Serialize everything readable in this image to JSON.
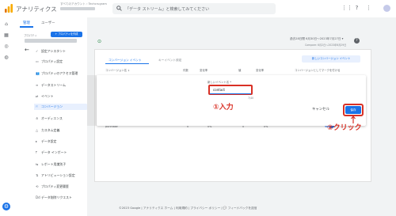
{
  "topbar": {
    "app_name": "アナリティクス",
    "account_crumb": "すべてのアカウント › Techcrugram",
    "search_placeholder": "「データ ストリーム」と検索してみてください"
  },
  "admin_tabs": [
    "管理",
    "ユーザー"
  ],
  "property": {
    "label": "プロパティ",
    "create_label": "+ プロパティを作成"
  },
  "nav_items": [
    {
      "icon": "✓",
      "label": "設定アシスタント"
    },
    {
      "icon": "▭",
      "label": "プロパティ設定"
    },
    {
      "icon": "👥",
      "label": "プロパティのアクセス管理"
    },
    {
      "icon": "≡",
      "label": "データストリーム"
    },
    {
      "icon": "⇄",
      "label": "イベント"
    },
    {
      "icon": "⚐",
      "label": "コンバージョン",
      "active": true
    },
    {
      "icon": "≗",
      "label": "オーディエンス"
    },
    {
      "icon": "△",
      "label": "カスタム定義"
    },
    {
      "icon": "▸",
      "label": "データ設定"
    },
    {
      "icon": "⤒",
      "label": "データ インポート"
    },
    {
      "icon": "⇆",
      "label": "レポート用識別子"
    },
    {
      "icon": "⇅",
      "label": "アトリビューション設定"
    },
    {
      "icon": "⟲",
      "label": "プロパティ変更履歴"
    },
    {
      "icon": "Dd",
      "label": "データ削除リクエスト"
    }
  ],
  "main": {
    "date_label": "過去28日間  6月30日〜2023年7月27日 ▾",
    "date_sub": "Compare: 6月2日〜2023年6月29日",
    "card_tabs": [
      "コンバージョン イベント",
      "キーイベント設定"
    ],
    "new_conversion_label": "新しいコンバージョン イベント",
    "columns": [
      "コンバージョン名 ↓",
      "件数",
      "変化率",
      "値",
      "変化率",
      "コンバージョンとしてマークを付ける"
    ],
    "rows": [
      {
        "name": "purchase",
        "count": "0",
        "change": "0%",
        "value": "0",
        "vchange": "0%"
      }
    ]
  },
  "dialog": {
    "label": "新しいイベント名 *",
    "input_value": "contact",
    "counter": "7/40",
    "cancel_label": "キャンセル",
    "save_label": "保存"
  },
  "annotations": {
    "input": "①入力",
    "click": "②クリック"
  },
  "footer": "©2023 Google | アナリティクス ホーム | 利用規約 | プライバシー ポリシー | 💬 フィードバックを送信",
  "colors": {
    "accent": "#1a73e8",
    "highlight": "#d93025",
    "logo": "#f9ab00"
  }
}
